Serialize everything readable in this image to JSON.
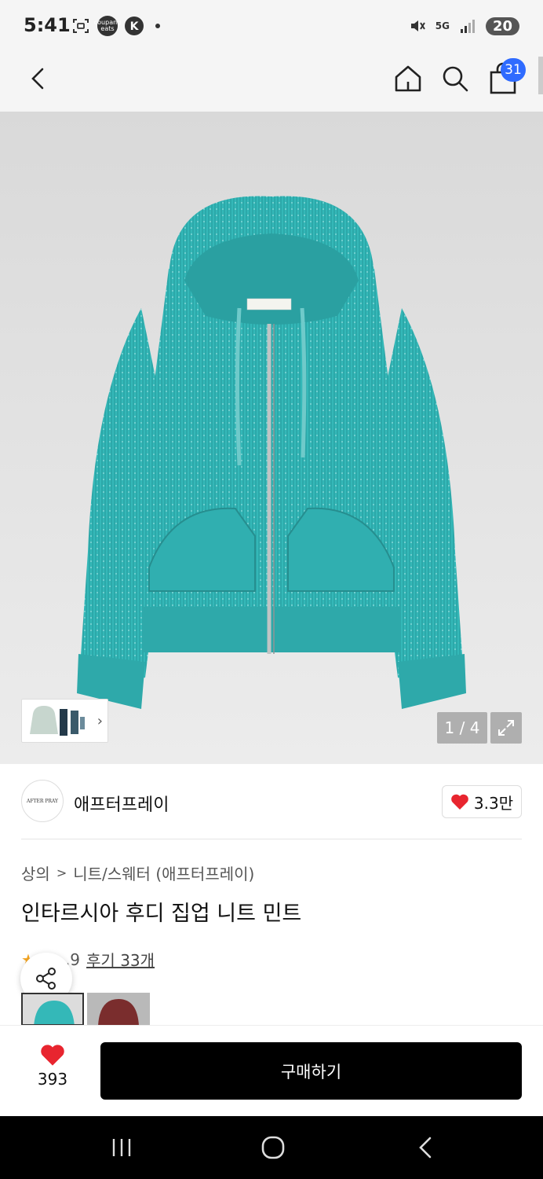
{
  "status_bar": {
    "time": "5:41",
    "left_badge_text": "coupang eats",
    "network": "5G",
    "battery": "20"
  },
  "header": {
    "cart_count": "31"
  },
  "gallery": {
    "page_indicator": "1 / 4"
  },
  "brand": {
    "logo_text": "AFTER PRAY",
    "name": "애프터프레이",
    "like_count": "3.3만"
  },
  "product": {
    "breadcrumb": [
      "상의",
      "니트/스웨터 (애프터프레이)"
    ],
    "title": "인타르시아 후디 집업 니트 민트",
    "rating_partial": ".9",
    "review_link": "후기 33개"
  },
  "bottom_bar": {
    "wish_count": "393",
    "buy_label": "구매하기"
  },
  "colors": {
    "garment": "#34b8b8",
    "heart": "#e8252f",
    "cart_badge": "#2f6bff",
    "buy_button": "#000000"
  }
}
